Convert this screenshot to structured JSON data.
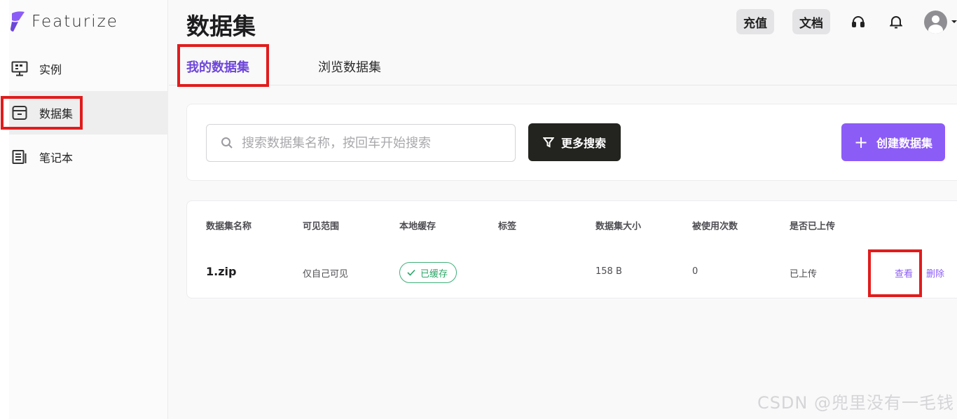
{
  "app": {
    "logo_text": "Featurize"
  },
  "sidebar": {
    "items": [
      {
        "label": "实例",
        "icon": "monitor-icon"
      },
      {
        "label": "数据集",
        "icon": "box-icon",
        "active": true
      },
      {
        "label": "笔记本",
        "icon": "notebook-icon"
      }
    ]
  },
  "header": {
    "title": "数据集",
    "recharge_label": "充值",
    "docs_label": "文档"
  },
  "tabs": [
    {
      "label": "我的数据集",
      "active": true
    },
    {
      "label": "浏览数据集"
    }
  ],
  "search": {
    "placeholder": "搜索数据集名称，按回车开始搜索",
    "more_label": "更多搜索",
    "create_label": "创建数据集"
  },
  "table": {
    "columns": [
      "数据集名称",
      "可见范围",
      "本地缓存",
      "标签",
      "数据集大小",
      "被使用次数",
      "是否已上传"
    ],
    "rows": [
      {
        "name": "1.zip",
        "visibility": "仅自己可见",
        "cache": "已缓存",
        "tags": "",
        "size": "158 B",
        "uses": "0",
        "uploaded": "已上传",
        "view_label": "查看",
        "delete_label": "删除"
      }
    ]
  },
  "watermark": "CSDN @兜里没有一毛钱",
  "colors": {
    "accent": "#8c5cf7",
    "active_tab": "#6e46d9",
    "success": "#2aa566",
    "highlight": "#e11c1c",
    "dark_button": "#23231f"
  }
}
